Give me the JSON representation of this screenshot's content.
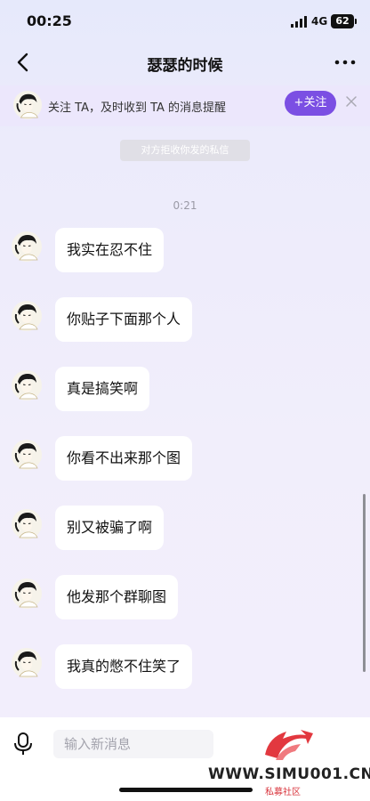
{
  "status_bar": {
    "time": "00:25",
    "network": "4G",
    "battery": "62"
  },
  "header": {
    "title": "瑟瑟的时候"
  },
  "follow_banner": {
    "text": "关注 TA，及时收到 TA 的消息提醒",
    "button": "+关注"
  },
  "system_notice": "对方拒收你发的私信",
  "timestamp": "0:21",
  "messages": [
    {
      "text": "我实在忍不住"
    },
    {
      "text": "你贴子下面那个人"
    },
    {
      "text": "真是搞笑啊"
    },
    {
      "text": "你看不出来那个图"
    },
    {
      "text": "别又被骗了啊"
    },
    {
      "text": "他发那个群聊图"
    },
    {
      "text": "我真的憋不住笑了"
    }
  ],
  "input": {
    "placeholder": "输入新消息"
  },
  "watermark": {
    "url": "WWW.SIMU001.CN",
    "sub": "私募社区"
  },
  "colors": {
    "accent": "#7b4fe3",
    "bubble": "#ffffff",
    "background": "#efecfb"
  }
}
